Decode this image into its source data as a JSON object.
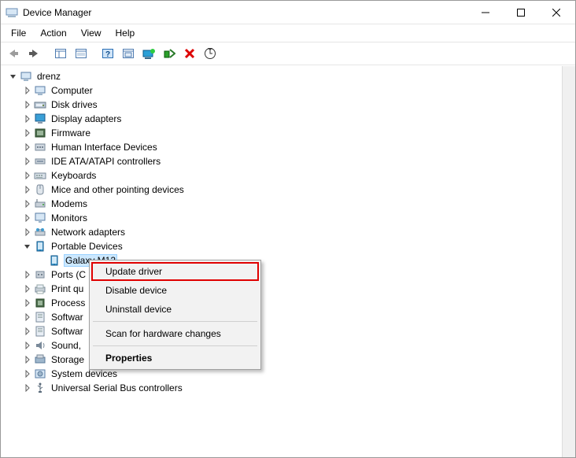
{
  "window": {
    "title": "Device Manager"
  },
  "menus": [
    "File",
    "Action",
    "View",
    "Help"
  ],
  "toolbar_icons": [
    "back",
    "forward",
    "properties-pane",
    "properties",
    "help",
    "find",
    "monitor",
    "install",
    "uninstall",
    "scan"
  ],
  "tree": {
    "root": {
      "label": "drenz",
      "expanded": true
    },
    "categories": [
      {
        "label": "Computer",
        "icon": "computer"
      },
      {
        "label": "Disk drives",
        "icon": "disk"
      },
      {
        "label": "Display adapters",
        "icon": "display"
      },
      {
        "label": "Firmware",
        "icon": "firmware"
      },
      {
        "label": "Human Interface Devices",
        "icon": "hid"
      },
      {
        "label": "IDE ATA/ATAPI controllers",
        "icon": "ide"
      },
      {
        "label": "Keyboards",
        "icon": "keyboard"
      },
      {
        "label": "Mice and other pointing devices",
        "icon": "mouse"
      },
      {
        "label": "Modems",
        "icon": "modem"
      },
      {
        "label": "Monitors",
        "icon": "monitor"
      },
      {
        "label": "Network adapters",
        "icon": "network"
      },
      {
        "label": "Portable Devices",
        "icon": "portable",
        "expanded": true,
        "children": [
          {
            "label": "Galaxy M12",
            "icon": "device",
            "selected": true
          }
        ]
      },
      {
        "label": "Ports (C",
        "icon": "ports"
      },
      {
        "label": "Print qu",
        "icon": "printer"
      },
      {
        "label": "Process",
        "icon": "cpu"
      },
      {
        "label": "Softwar",
        "icon": "software"
      },
      {
        "label": "Softwar",
        "icon": "software"
      },
      {
        "label": "Sound,",
        "icon": "sound"
      },
      {
        "label": "Storage",
        "icon": "storage"
      },
      {
        "label": "System devices",
        "icon": "system"
      },
      {
        "label": "Universal Serial Bus controllers",
        "icon": "usb"
      }
    ]
  },
  "context_menu": {
    "items": [
      {
        "label": "Update driver",
        "highlight": true
      },
      {
        "label": "Disable device"
      },
      {
        "label": "Uninstall device"
      },
      {
        "sep": true
      },
      {
        "label": "Scan for hardware changes"
      },
      {
        "sep": true
      },
      {
        "label": "Properties",
        "bold": true
      }
    ]
  }
}
